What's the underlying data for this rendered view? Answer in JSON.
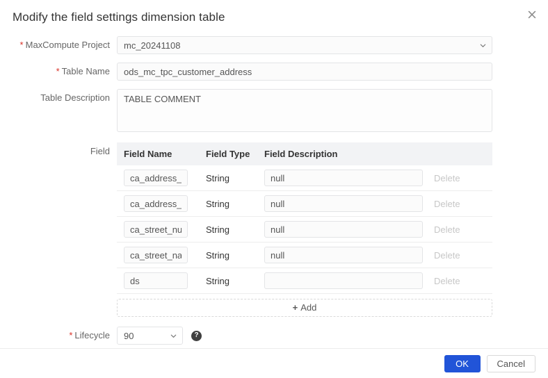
{
  "dialog": {
    "title": "Modify the field settings dimension table",
    "close_icon": "close-icon"
  },
  "form": {
    "project": {
      "label": "MaxCompute Project",
      "required": true,
      "value": "mc_20241108",
      "placeholder": "",
      "caret_icon": "chevron-down-icon"
    },
    "table_name": {
      "label": "Table Name",
      "required": true,
      "value": "ods_mc_tpc_customer_address",
      "placeholder": ""
    },
    "table_description": {
      "label": "Table Description",
      "required": false,
      "value": "TABLE COMMENT",
      "placeholder": ""
    },
    "field": {
      "label": "Field"
    },
    "lifecycle": {
      "label": "Lifecycle",
      "required": true,
      "value": "90",
      "help_icon": "question-mark-icon",
      "caret_icon": "chevron-down-icon"
    }
  },
  "field_table": {
    "headers": {
      "name": "Field Name",
      "type": "Field Type",
      "description": "Field Description",
      "action": ""
    },
    "rows": [
      {
        "name": "ca_address_sk",
        "type": "String",
        "description": "null",
        "action": "Delete"
      },
      {
        "name": "ca_address_id",
        "type": "String",
        "description": "null",
        "action": "Delete"
      },
      {
        "name": "ca_street_number",
        "type": "String",
        "description": "null",
        "action": "Delete"
      },
      {
        "name": "ca_street_name",
        "type": "String",
        "description": "null",
        "action": "Delete"
      },
      {
        "name": "ds",
        "type": "String",
        "description": "",
        "action": "Delete"
      }
    ],
    "add_label": "Add",
    "add_plus": "+"
  },
  "footer": {
    "ok_label": "OK",
    "cancel_label": "Cancel"
  },
  "colors": {
    "primary": "#2154d8",
    "required_star": "#d93026",
    "header_bg": "#f2f3f5",
    "border": "#e3e4e6"
  }
}
